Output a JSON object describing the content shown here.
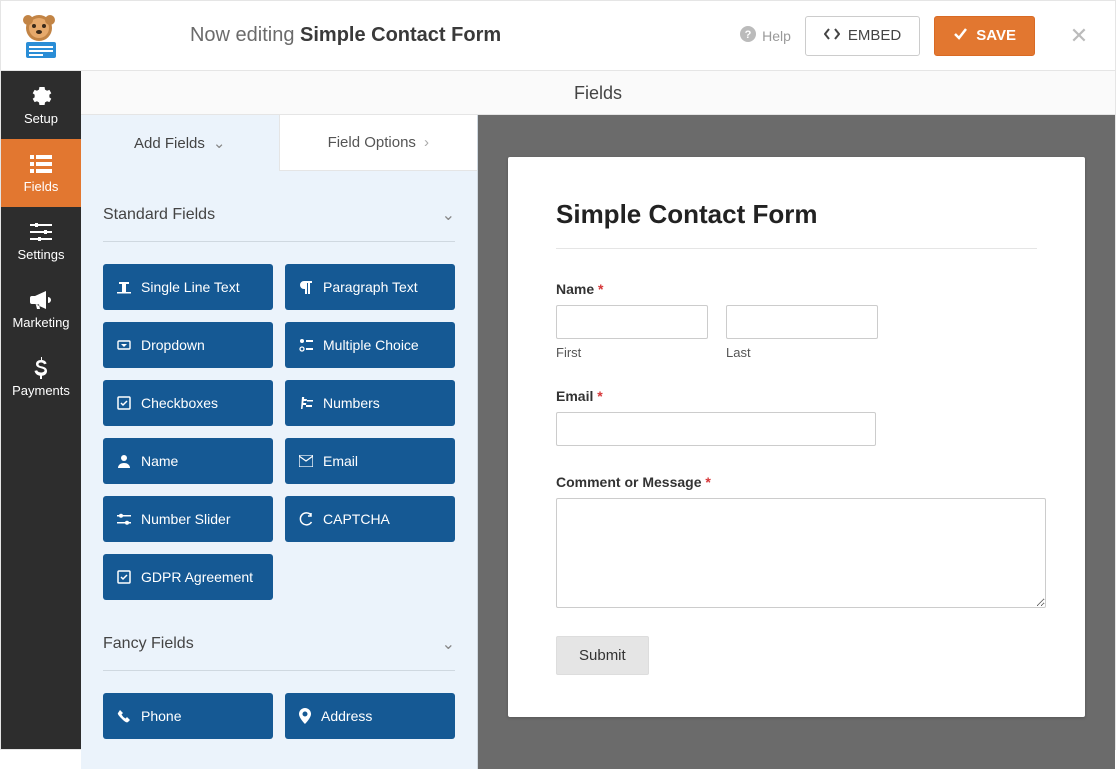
{
  "header": {
    "editing_prefix": "Now editing ",
    "form_name": "Simple Contact Form",
    "help_label": "Help",
    "embed_label": "EMBED",
    "save_label": "SAVE"
  },
  "rail": {
    "items": [
      {
        "id": "setup",
        "label": "Setup"
      },
      {
        "id": "fields",
        "label": "Fields"
      },
      {
        "id": "settings",
        "label": "Settings"
      },
      {
        "id": "marketing",
        "label": "Marketing"
      },
      {
        "id": "payments",
        "label": "Payments"
      }
    ]
  },
  "section_title": "Fields",
  "panel": {
    "tab_add": "Add Fields",
    "tab_options": "Field Options",
    "standard_heading": "Standard Fields",
    "fancy_heading": "Fancy Fields",
    "standard": [
      "Single Line Text",
      "Paragraph Text",
      "Dropdown",
      "Multiple Choice",
      "Checkboxes",
      "Numbers",
      "Name",
      "Email",
      "Number Slider",
      "CAPTCHA",
      "GDPR Agreement"
    ],
    "fancy": [
      "Phone",
      "Address"
    ]
  },
  "form": {
    "title": "Simple Contact Form",
    "name_label": "Name",
    "first": "First",
    "last": "Last",
    "email_label": "Email",
    "message_label": "Comment or Message",
    "submit": "Submit"
  }
}
